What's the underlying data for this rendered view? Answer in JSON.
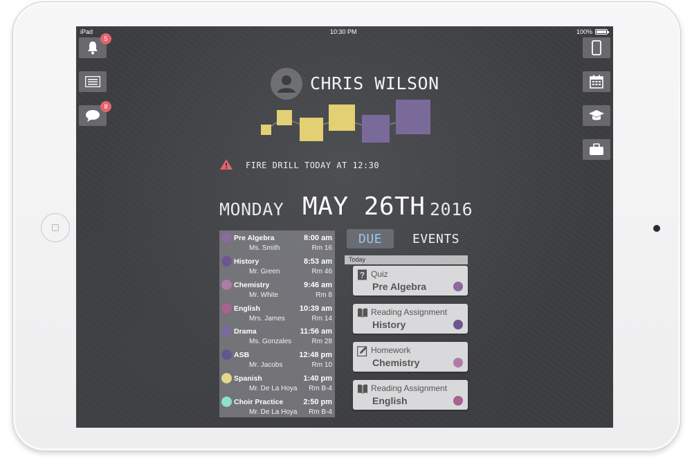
{
  "status_bar": {
    "device": "iPad",
    "time": "10:30 PM",
    "battery": "100%"
  },
  "left_nav": {
    "notifications_badge": "5",
    "messages_badge": "8"
  },
  "profile": {
    "name": "CHRIS WILSON"
  },
  "alert": {
    "text": "FIRE DRILL TODAY AT 12:30",
    "color": "#e5646b"
  },
  "date": {
    "day": "MONDAY",
    "main": "MAY 26TH",
    "year": "2016"
  },
  "schedule": [
    {
      "subject": "Pre Algebra",
      "time": "8:00 am",
      "teacher": "Ms. Smith",
      "room": "Rm 16",
      "color": "#8a6aa0"
    },
    {
      "subject": "History",
      "time": "8:53 am",
      "teacher": "Mr. Green",
      "room": "Rm 46",
      "color": "#6f5590"
    },
    {
      "subject": "Chemistry",
      "time": "9:46 am",
      "teacher": "Mr. White",
      "room": "Rm 8",
      "color": "#b07aa8"
    },
    {
      "subject": "English",
      "time": "10:39 am",
      "teacher": "Mrs. James",
      "room": "Rm 14",
      "color": "#a8628f"
    },
    {
      "subject": "Drama",
      "time": "11:56 am",
      "teacher": "Ms. Gonzales",
      "room": "Rm 28",
      "color": "#7a6aa0"
    },
    {
      "subject": "ASB",
      "time": "12:48 pm",
      "teacher": "Mr. Jacobs",
      "room": "Rm 10",
      "color": "#5e5890"
    },
    {
      "subject": "Spanish",
      "time": "1:40 pm",
      "teacher": "Mr. De La Hoya",
      "room": "Rm B-4",
      "color": "#e2d98a"
    },
    {
      "subject": "Choir Practice",
      "time": "2:50 pm",
      "teacher": "Mr. De La Hoya",
      "room": "Rm B-4",
      "color": "#8ee0cf"
    }
  ],
  "tabs": {
    "due": "DUE",
    "events": "EVENTS"
  },
  "due_section": {
    "label": "Today"
  },
  "due_items": [
    {
      "type": "Quiz",
      "subject": "Pre Algebra",
      "icon": "question-icon",
      "color": "#8a6aa0"
    },
    {
      "type": "Reading Assignment",
      "subject": "History",
      "icon": "book-icon",
      "color": "#6f5590"
    },
    {
      "type": "Homework",
      "subject": "Chemistry",
      "icon": "pencil-icon",
      "color": "#b07aa8"
    },
    {
      "type": "Reading Assignment",
      "subject": "English",
      "icon": "book-icon",
      "color": "#a8628f"
    }
  ],
  "progress_colors": {
    "yellow": "#e3cf74",
    "purple": "#7a6a9a"
  }
}
